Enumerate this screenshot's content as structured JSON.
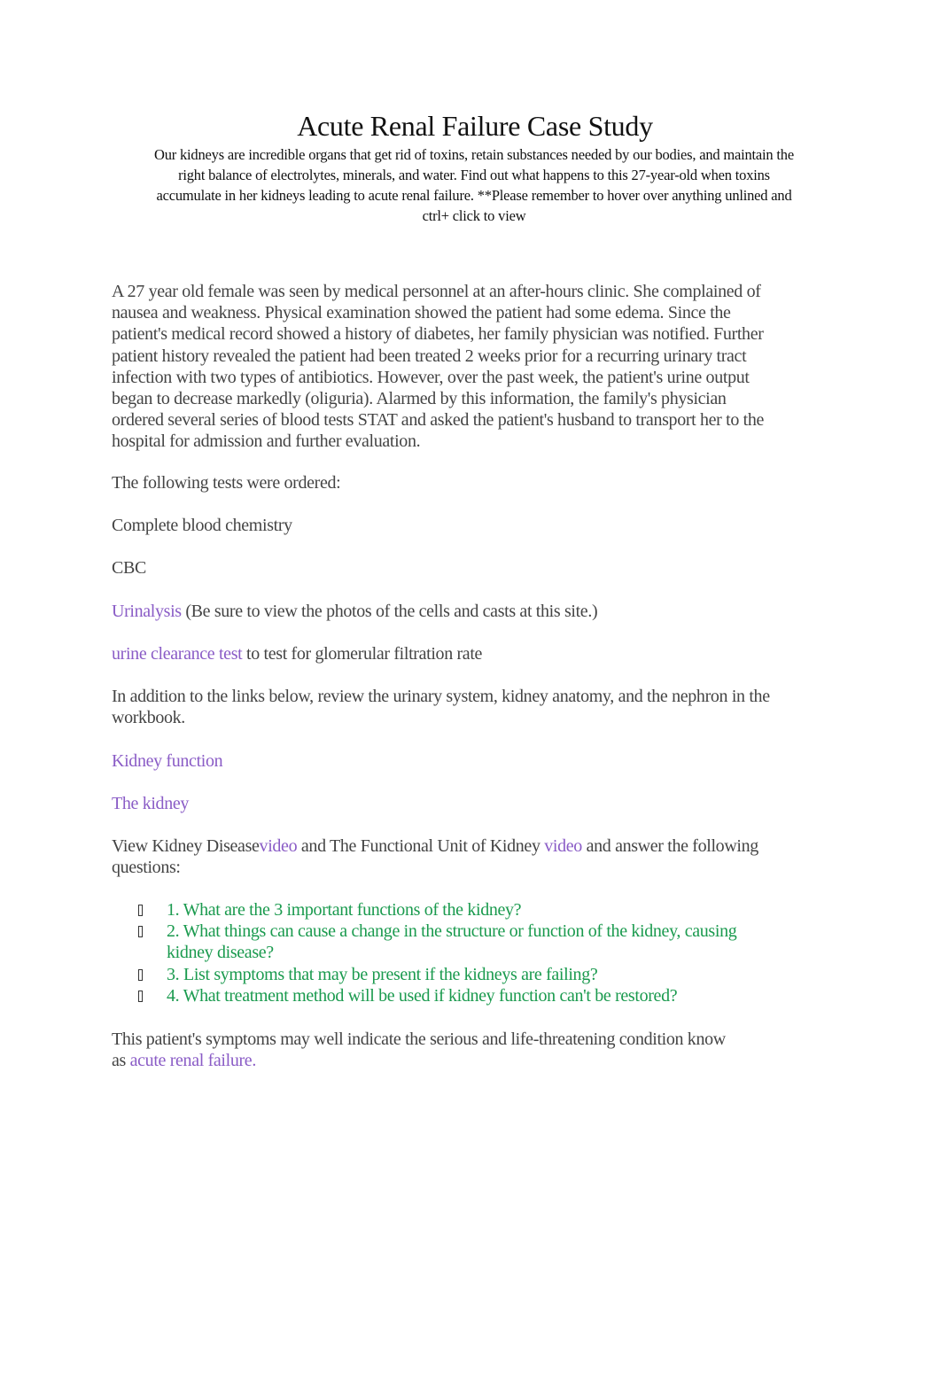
{
  "document": {
    "title": "Acute Renal Failure Case Study",
    "intro_lines": [
      "Our kidneys are incredible organs that get rid of toxins, retain substances needed by our bodies, and maintain the",
      "right balance of electrolytes, minerals, and water. Find out what happens to this 27-year-old when toxins",
      "accumulate in her kidneys leading to acute renal failure. **Please remember to hover over anything unlined and",
      "ctrl+ click to view"
    ],
    "case_paragraph_lines": [
      "A 27 year old female was seen by medical personnel at an after-hours clinic. She complained of",
      "nausea and weakness. Physical examination showed the patient had some edema. Since the",
      "patient's medical record showed a history of diabetes, her family physician was notified. Further",
      "patient history revealed the patient had been treated 2 weeks prior for a recurring urinary tract",
      "infection with two types of antibiotics. However, over the past week, the patient's urine output",
      "began to decrease markedly (oliguria). Alarmed by this information, the family's physician",
      "ordered several series of blood tests STAT and asked the patient's husband to transport her to the",
      "hospital for admission and further evaluation."
    ],
    "tests_intro": "The following tests were ordered:",
    "tests": {
      "blood_chemistry": "Complete blood chemistry",
      "cbc": "CBC",
      "urinalysis_link": "Urinalysis",
      "urinalysis_note": "(Be sure to view the photos of the cells and casts at this site.)",
      "clearance_link": "urine clearance test",
      "clearance_note": "to test for glomerular filtration rate"
    },
    "review_lines": [
      "In addition to the links below, review the urinary system, kidney anatomy, and the nephron in the",
      "workbook."
    ],
    "links": {
      "kidney_function": "Kidney function",
      "the_kidney": "The kidney"
    },
    "video_sentence": {
      "part1": "View Kidney Disease",
      "link1": "video",
      "part2": "and The Functional Unit of Kidney",
      "link2": "video",
      "part3": "and answer the following",
      "line2": "questions:"
    },
    "questions": [
      {
        "text": "1. What are the 3 important functions of the kidney?",
        "continuation": ""
      },
      {
        "text": "2. What things can cause a change in the structure or function of the kidney, causing",
        "continuation": "kidney disease?"
      },
      {
        "text": "3. List symptoms that may be present if the kidneys are failing?",
        "continuation": ""
      },
      {
        "text": "4. What treatment method will be used if kidney function can't be restored?",
        "continuation": ""
      }
    ],
    "conclusion": {
      "line1": "This patient's symptoms may well indicate the serious and life-threatening condition know",
      "prefix": "as",
      "link": "acute renal failure."
    },
    "colors": {
      "body_text": "#444444",
      "link": "#8a5cc6",
      "question": "#1a9a4e",
      "heading": "#111111"
    }
  }
}
